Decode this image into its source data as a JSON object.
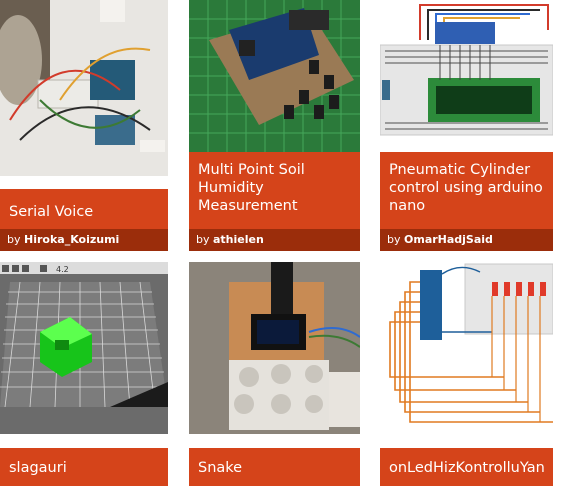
{
  "cards": [
    {
      "title": "Serial Voice",
      "by_label": "by",
      "author": "Hiroka_Koizumi"
    },
    {
      "title": "Multi Point Soil Humidity Measurement",
      "by_label": "by",
      "author": "athielen"
    },
    {
      "title": "Pneumatic Cylinder control using arduino nano",
      "by_label": "by",
      "author": "OmarHadjSaid"
    },
    {
      "title": "slagauri"
    },
    {
      "title": "Snake"
    },
    {
      "title": "onLedHizKontrolluYan"
    }
  ],
  "colors": {
    "title_bg": "#d5441a",
    "author_bg": "#9b2d0b"
  },
  "icons": [
    "arduino-wiring-photo",
    "soil-sensor-board-photo",
    "lcd-breadboard-diagram",
    "3d-model-editor-screenshot",
    "oled-game-photo",
    "led-breadboard-diagram"
  ],
  "thumb_text": {
    "cad_toolbar_value": "4.2"
  }
}
